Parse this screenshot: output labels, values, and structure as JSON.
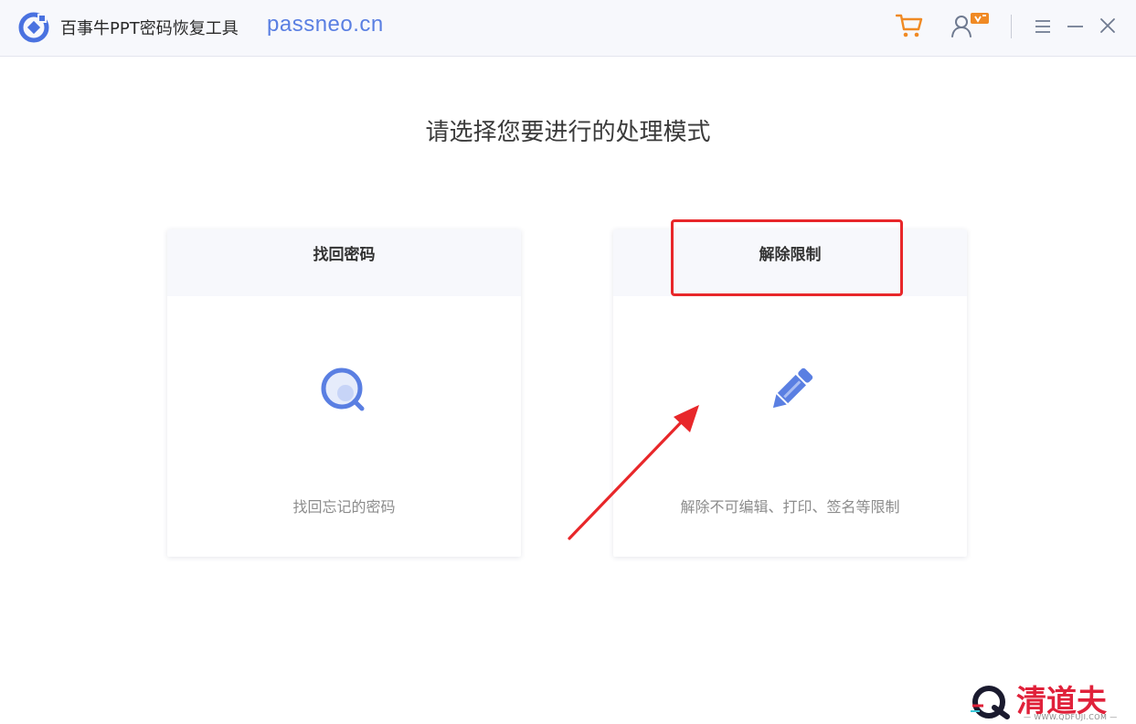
{
  "titlebar": {
    "app_title": "百事牛PPT密码恢复工具",
    "site_url": "passneo.cn"
  },
  "main": {
    "heading": "请选择您要进行的处理模式",
    "cards": [
      {
        "title": "找回密码",
        "description": "找回忘记的密码",
        "icon": "magnifier-icon"
      },
      {
        "title": "解除限制",
        "description": "解除不可编辑、打印、签名等限制",
        "icon": "pencil-icon"
      }
    ]
  },
  "watermark": {
    "brand": "清道夫",
    "url": "— WWW.QDFUJI.COM —"
  },
  "colors": {
    "accent": "#5a7fe2",
    "cart_orange": "#f08a24",
    "annotation_red": "#e8272a"
  }
}
